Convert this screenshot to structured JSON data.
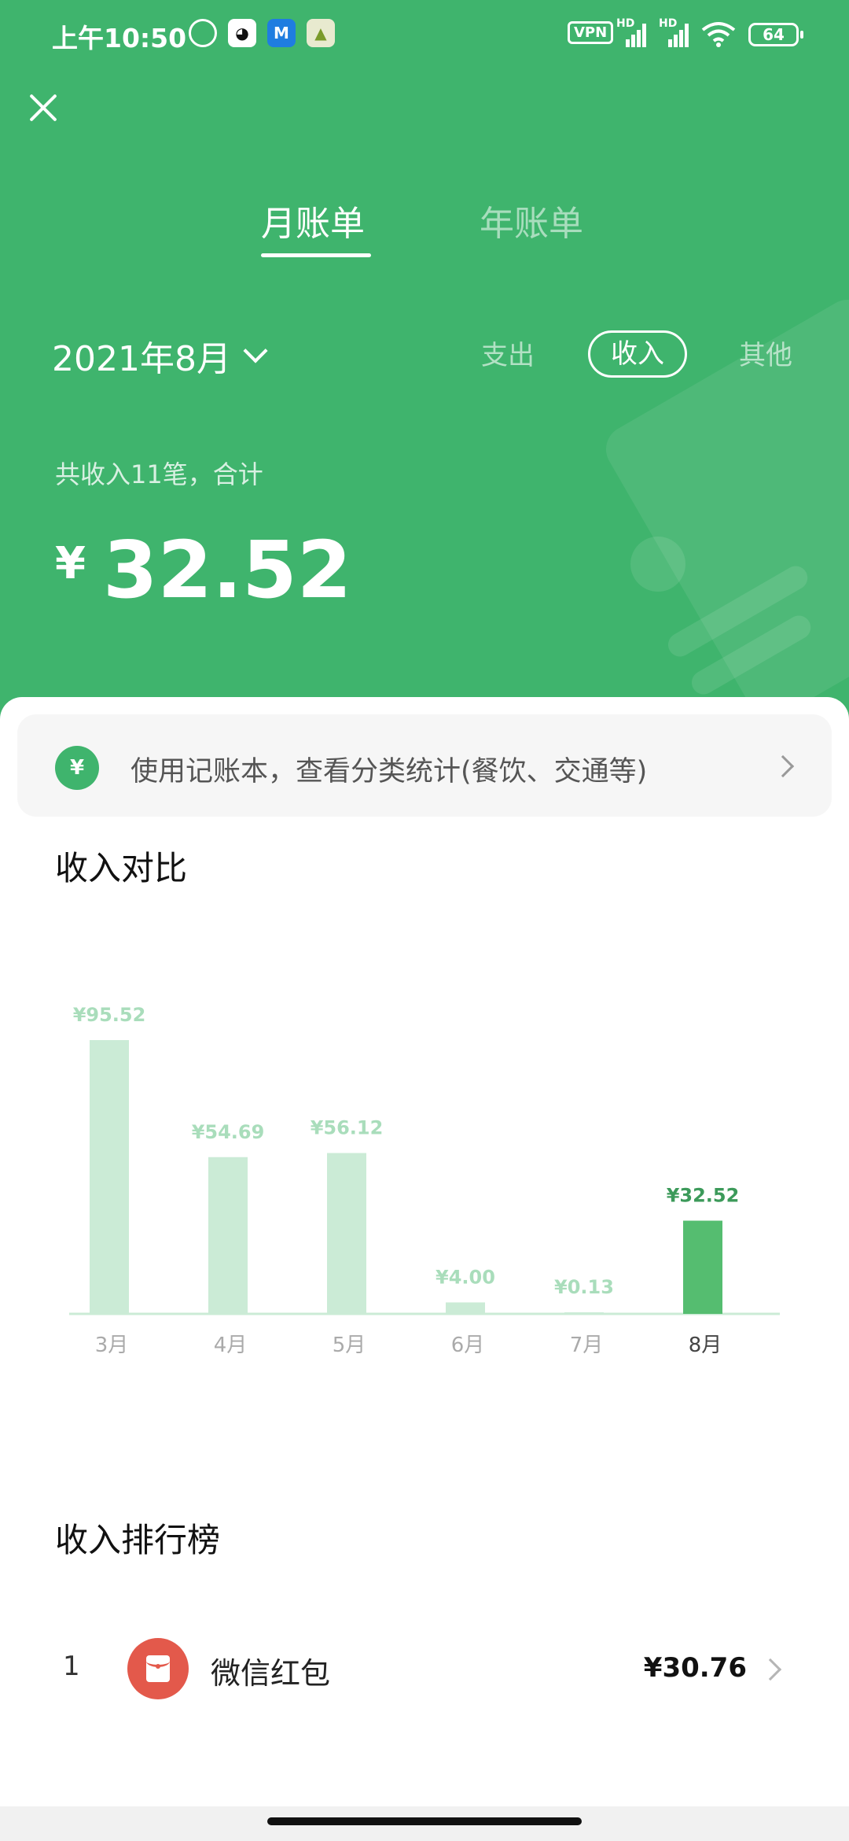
{
  "status_bar": {
    "time": "上午10:50",
    "notification_icons": [
      "alarm-icon",
      "qq-icon",
      "app-m-icon",
      "android-app-icon"
    ],
    "vpn": "VPN",
    "signal_hd": "HD",
    "battery": "64"
  },
  "tabs": {
    "monthly": "月账单",
    "yearly": "年账单"
  },
  "date_selector": {
    "label": "2021年8月"
  },
  "filters": {
    "expense": "支出",
    "income": "收入",
    "other": "其他",
    "selected": "收入"
  },
  "summary": {
    "text": "共收入11笔，合计",
    "currency": "¥",
    "amount": "32.52"
  },
  "banner": {
    "text": "使用记账本，查看分类统计(餐饮、交通等)"
  },
  "comparison": {
    "title": "收入对比"
  },
  "chart_data": {
    "type": "bar",
    "categories": [
      "3月",
      "4月",
      "5月",
      "6月",
      "7月",
      "8月"
    ],
    "values": [
      95.52,
      54.69,
      56.12,
      4.0,
      0.13,
      32.52
    ],
    "value_labels": [
      "¥95.52",
      "¥54.69",
      "¥56.12",
      "¥4.00",
      "¥0.13",
      "¥32.52"
    ],
    "highlight_index": 5,
    "ylim": [
      0,
      95.52
    ],
    "colors": {
      "bar": "#cbebd6",
      "highlight": "#55bd70",
      "label": "#a9ddbb",
      "highlight_label": "#3c9a5a",
      "baseline": "#cbebd6"
    }
  },
  "ranking": {
    "title": "收入排行榜",
    "items": [
      {
        "rank": "1",
        "name": "微信红包",
        "amount": "¥30.76",
        "icon": "red-envelope-icon"
      }
    ]
  },
  "colors": {
    "brand_green": "#3fb46d",
    "red_envelope": "#e3594b"
  }
}
